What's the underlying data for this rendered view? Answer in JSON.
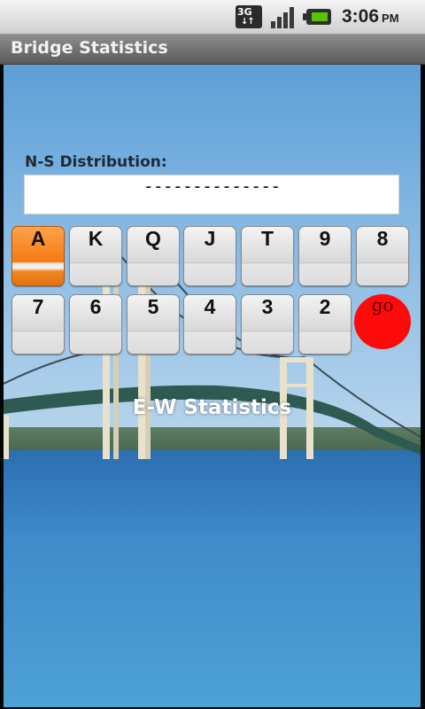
{
  "status_bar": {
    "network_icon": "3g-data-icon",
    "network_label": "3G",
    "signal_icon": "signal-strength-icon",
    "battery_icon": "battery-charging-icon",
    "time": "3:06",
    "ampm": "PM"
  },
  "app": {
    "title": "Bridge Statistics"
  },
  "ns": {
    "label": "N-S Distribution:",
    "value": "--------------"
  },
  "keys": {
    "row1": [
      "A",
      "K",
      "Q",
      "J",
      "T",
      "9",
      "8"
    ],
    "row2": [
      "7",
      "6",
      "5",
      "4",
      "3",
      "2"
    ],
    "selected": "A",
    "go_label": "go"
  },
  "ew": {
    "label": "E-W Statistics"
  },
  "colors": {
    "selected_key": "#f47a12",
    "go_button": "#ff0a0a",
    "title_bar": "#6e6e6e"
  }
}
